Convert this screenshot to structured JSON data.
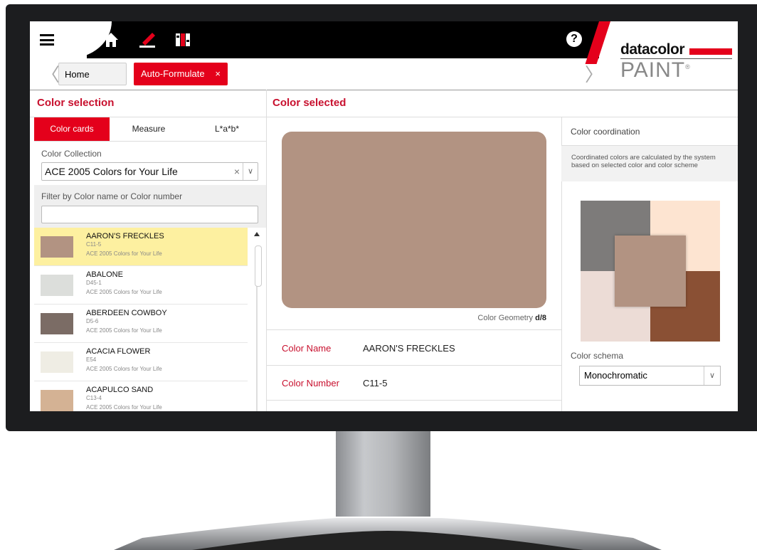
{
  "header": {
    "menu_icon": "hamburger-icon",
    "icons": [
      "home-icon",
      "pen-swatch-icon",
      "color-fan-icon"
    ],
    "help_icon": "help-icon",
    "help_glyph": "?",
    "logo_line1": "datacolor",
    "logo_line2": "PAINT",
    "logo_mark": "®",
    "accent_color": "#e4001b"
  },
  "breadcrumb": {
    "back_glyph": "〈",
    "forward_glyph": "〉",
    "home_label": "Home",
    "active_label": "Auto-Formulate",
    "close_glyph": "×"
  },
  "left": {
    "title": "Color selection",
    "tabs": [
      {
        "label": "Color cards",
        "active": true
      },
      {
        "label": "Measure",
        "active": false
      },
      {
        "label": "L*a*b*",
        "active": false
      }
    ],
    "collection_label": "Color Collection",
    "collection_value": "ACE 2005 Colors for Your Life",
    "clear_glyph": "×",
    "dropdown_glyph": "∨",
    "filter_label": "Filter by Color name or Color number",
    "filter_value": "",
    "items": [
      {
        "name": "AARON'S FRECKLES",
        "number": "C11-5",
        "collection": "ACE 2005 Colors for Your Life",
        "color": "#b29382",
        "selected": true
      },
      {
        "name": "ABALONE",
        "number": "D45-1",
        "collection": "ACE 2005 Colors for Your Life",
        "color": "#dcdedb",
        "selected": false
      },
      {
        "name": "ABERDEEN COWBOY",
        "number": "D5-6",
        "collection": "ACE 2005 Colors for Your Life",
        "color": "#7b6c65",
        "selected": false
      },
      {
        "name": "ACACIA FLOWER",
        "number": "E54",
        "collection": "ACE 2005 Colors for Your Life",
        "color": "#efede4",
        "selected": false
      },
      {
        "name": "ACAPULCO SAND",
        "number": "C13-4",
        "collection": "ACE 2005 Colors for Your Life",
        "color": "#d4b294",
        "selected": false
      }
    ]
  },
  "center": {
    "title": "Color selected",
    "swatch_color": "#b29382",
    "geometry_label": "Color Geometry",
    "geometry_value": "d/8",
    "name_label": "Color Name",
    "name_value": "AARON'S FRECKLES",
    "number_label": "Color Number",
    "number_value": "C11-5"
  },
  "right": {
    "title": "Color coordination",
    "description": "Coordinated colors are calculated by the system based on selected color and color scheme",
    "coord_colors": {
      "top_left": "#7d7b7a",
      "top_right": "#fde4d1",
      "bottom_left": "#ecdcd6",
      "bottom_right": "#8a5034",
      "center": "#b29382"
    },
    "schema_label": "Color schema",
    "schema_value": "Monochromatic"
  }
}
